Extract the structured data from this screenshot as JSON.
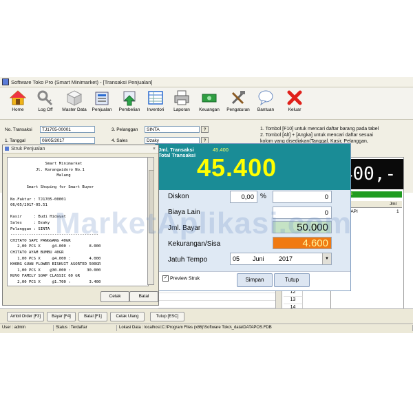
{
  "window": {
    "title": "Software Toko Pro (Smart Minimarket) - [Transaksi Penjualan]"
  },
  "toolbar": [
    {
      "label": "Home",
      "icon": "home-icon"
    },
    {
      "label": "Log Off",
      "icon": "key-icon"
    },
    {
      "label": "Master Data",
      "icon": "cube-icon"
    },
    {
      "label": "Penjualan",
      "icon": "cash-register-icon"
    },
    {
      "label": "Pembelian",
      "icon": "download-icon"
    },
    {
      "label": "Inventori",
      "icon": "inventory-icon"
    },
    {
      "label": "Laporan",
      "icon": "printer-icon"
    },
    {
      "label": "Keuangan",
      "icon": "money-icon"
    },
    {
      "label": "Pengaturan",
      "icon": "tools-icon"
    },
    {
      "label": "Bantuan",
      "icon": "speech-bubble-icon"
    },
    {
      "label": "Keluar",
      "icon": "close-icon"
    }
  ],
  "form": {
    "no_transaksi_label": "No. Transaksi",
    "no_transaksi_value": "TJ1705-00001",
    "tanggal_label": "1. Tanggal",
    "tanggal_value": "06/05/2017",
    "pelanggan_label": "3. Pelanggan",
    "pelanggan_value": "SINTA",
    "sales_label": "4. Sales",
    "sales_value": "Dzaky",
    "query_button": "?"
  },
  "hints": [
    "1. Tombol [F10] untuk mencari daftar barang pada tabel",
    "2. Tombol [Alt] + [Angka] untuk mencari daftar sesuai",
    "kolom yang disediakan(Tanggal, Kasir, Pelanggan,"
  ],
  "right_panel": {
    "big_total": "400,-",
    "green_label": "onus",
    "col_header": "Jml",
    "row_item": "SAPI",
    "row_qty": "1"
  },
  "grid": {
    "row_numbers": [
      "12",
      "13",
      "14"
    ]
  },
  "payment": {
    "jml_transaksi_label": "Jml. Transaksi",
    "jml_transaksi_value": "45.400",
    "total_transaksi_label": "Total Transaksi",
    "total_value": "45.400",
    "diskon_label": "Diskon",
    "diskon_pct": "0,00",
    "pct_sign": "%",
    "diskon_amount": "0",
    "biaya_lain_label": "Biaya Lain",
    "biaya_lain_value": "0",
    "jml_bayar_label": "Jml. Bayar",
    "jml_bayar_value": "50.000",
    "kekurangan_label": "Kekurangan/Sisa",
    "kekurangan_value": "4.600",
    "jatuh_tempo_label": "Jatuh Tempo",
    "tempo_day": "05",
    "tempo_month": "Juni",
    "tempo_year": "2017",
    "preview_label": "Preview Struk",
    "simpan_label": "Simpan",
    "tutup_label": "Tutup"
  },
  "struk": {
    "title": "Struk Penjualan",
    "close": "×",
    "lines": [
      "               Smart Minimarket",
      "           Jl. Karangwidoro No.1",
      "                    Malang",
      "",
      "       Smart Shoping for Smart Buyer",
      "",
      "No.Faktur : TJ1705-00001",
      "06/05/2017-05.51",
      "",
      "Kasir     : Budi Hidayat",
      "Sales     : Dzaky",
      "Pelanggan : SINTA",
      "--------------------------------------",
      "CHITATO SAPI PANGGANG 40GR",
      "   2,00 PCS X     @4.000 :        8.000",
      "CHITATO AYAM BUMBU 40GR",
      "   1,00 PCS X     @4.000 :        4.000",
      "KHONG GUAN FLOWER BISKUIT ASORTED 500GR",
      "   1,00 PCS X    @30.000 :       30.000",
      "NUVO FAMILY SOAP CLASSIC 60 GR",
      "   2,00 PCS X     @1.700 :        3.400"
    ],
    "cetak_label": "Cetak",
    "batal_label": "Batal"
  },
  "bottom_buttons": [
    "Ambil Order [F3]",
    "Bayar [F4]",
    "Batal [F1]",
    "Cetak Ulang",
    "Tutup [ESC]"
  ],
  "status": {
    "user": "User : admin",
    "status": "Status : Terdaftar",
    "lokasi": "Lokasi Data : localhost:C:\\Program Files (x86)\\Software Toko\\_data\\DATAPOS.FDB"
  },
  "watermark": "MarketAplikasi.com",
  "colors": {
    "header_teal": "#1a8c96",
    "total_yellow": "#ffff00",
    "change_orange": "#f07a12",
    "paid_green": "#c5e3c5"
  }
}
